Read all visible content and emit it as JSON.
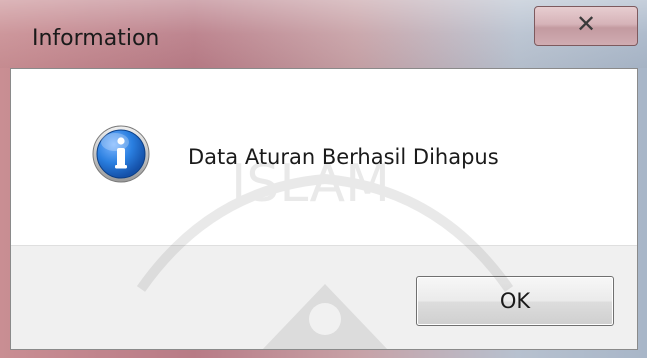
{
  "window": {
    "title": "Information"
  },
  "message": {
    "text": "Data Aturan Berhasil Dihapus",
    "icon": "information-icon"
  },
  "buttons": {
    "ok_label": "OK",
    "close_icon": "close-icon",
    "close_glyph": "✕"
  },
  "colors": {
    "titlebar_accent": "#c98e93",
    "button_area": "#f0f0f0",
    "info_icon": "#1f6fd1"
  },
  "watermark": {
    "text": "ISLAM"
  }
}
